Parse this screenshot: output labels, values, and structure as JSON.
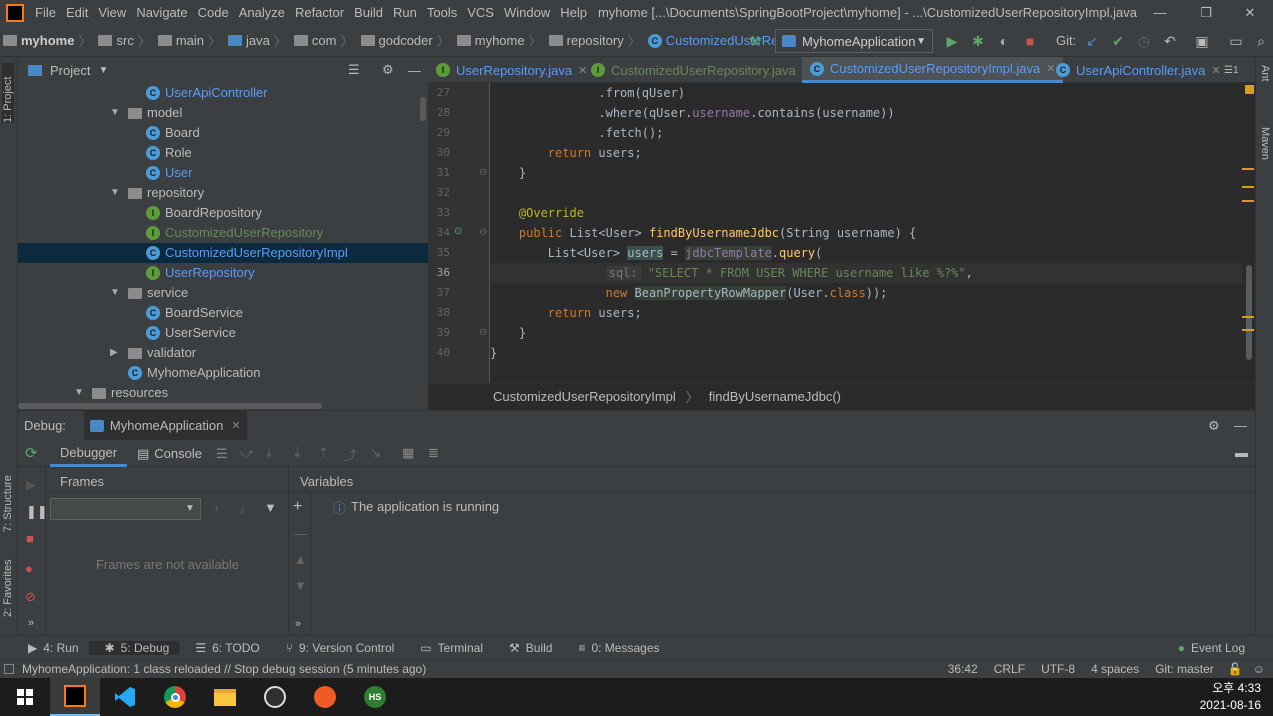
{
  "menubar": {
    "items": [
      "File",
      "Edit",
      "View",
      "Navigate",
      "Code",
      "Analyze",
      "Refactor",
      "Build",
      "Run",
      "Tools",
      "VCS",
      "Window",
      "Help"
    ],
    "title": "myhome [...\\Documents\\SpringBootProject\\myhome] - ...\\CustomizedUserRepositoryImpl.java"
  },
  "nav": {
    "crumbs": [
      "myhome",
      "src",
      "main",
      "java",
      "com",
      "godcoder",
      "myhome",
      "repository",
      "CustomizedUserRepositoryImpl"
    ],
    "run_config": "MyhomeApplication",
    "git_label": "Git:"
  },
  "project": {
    "title": "Project",
    "tree": [
      {
        "label": "UserApiController",
        "kind": "class",
        "color": "blue"
      },
      {
        "label": "model",
        "kind": "folder",
        "arrow": "▼"
      },
      {
        "label": "Board",
        "kind": "class"
      },
      {
        "label": "Role",
        "kind": "class"
      },
      {
        "label": "User",
        "kind": "class",
        "color": "blue"
      },
      {
        "label": "repository",
        "kind": "folder",
        "arrow": "▼"
      },
      {
        "label": "BoardRepository",
        "kind": "interface"
      },
      {
        "label": "CustomizedUserRepository",
        "kind": "interface",
        "color": "green"
      },
      {
        "label": "CustomizedUserRepositoryImpl",
        "kind": "class",
        "color": "blue",
        "selected": true
      },
      {
        "label": "UserRepository",
        "kind": "interface",
        "color": "blue"
      },
      {
        "label": "service",
        "kind": "folder",
        "arrow": "▼"
      },
      {
        "label": "BoardService",
        "kind": "class"
      },
      {
        "label": "UserService",
        "kind": "class"
      },
      {
        "label": "validator",
        "kind": "folder",
        "arrow": "▶"
      },
      {
        "label": "MyhomeApplication",
        "kind": "class"
      },
      {
        "label": "resources",
        "kind": "folder",
        "arrow": "▼"
      }
    ]
  },
  "tabs": [
    {
      "label": "UserRepository.java",
      "kind": "interface",
      "color": "blue"
    },
    {
      "label": "CustomizedUserRepository.java",
      "kind": "interface",
      "color": "green"
    },
    {
      "label": "CustomizedUserRepositoryImpl.java",
      "kind": "class",
      "color": "blue",
      "active": true
    },
    {
      "label": "UserApiController.java",
      "kind": "class",
      "color": "blue"
    }
  ],
  "tabs_overflow": "1",
  "editor": {
    "line_numbers": [
      "27",
      "28",
      "29",
      "30",
      "31",
      "32",
      "33",
      "34",
      "35",
      "36",
      "37",
      "38",
      "39",
      "40"
    ],
    "breadcrumb_class": "CustomizedUserRepositoryImpl",
    "breadcrumb_method": "findByUsernameJdbc()"
  },
  "debug": {
    "label": "Debug:",
    "session": "MyhomeApplication",
    "debugger_tab": "Debugger",
    "console_tab": "Console",
    "frames_title": "Frames",
    "frames_empty": "Frames are not available",
    "variables_title": "Variables",
    "running_msg": "The application is running"
  },
  "bottom_tools": [
    {
      "label": "4: Run",
      "icon": "run-icon"
    },
    {
      "label": "5: Debug",
      "icon": "debug-icon",
      "active": true
    },
    {
      "label": "6: TODO",
      "icon": "todo-icon"
    },
    {
      "label": "9: Version Control",
      "icon": "vcs-icon"
    },
    {
      "label": "Terminal",
      "icon": "terminal-icon"
    },
    {
      "label": "Build",
      "icon": "build-icon"
    },
    {
      "label": "0: Messages",
      "icon": "messages-icon"
    }
  ],
  "event_log": "Event Log",
  "status": {
    "message": "MyhomeApplication: 1 class reloaded // Stop debug session (5 minutes ago)",
    "position": "36:42",
    "line_sep": "CRLF",
    "encoding": "UTF-8",
    "indent": "4 spaces",
    "git": "Git: master"
  },
  "sidebars": {
    "project": "1: Project",
    "structure": "7: Structure",
    "favorites": "2: Favorites",
    "ant": "Ant",
    "maven": "Maven"
  },
  "taskbar": {
    "time": "오후 4:33",
    "date": "2021-08-16"
  }
}
